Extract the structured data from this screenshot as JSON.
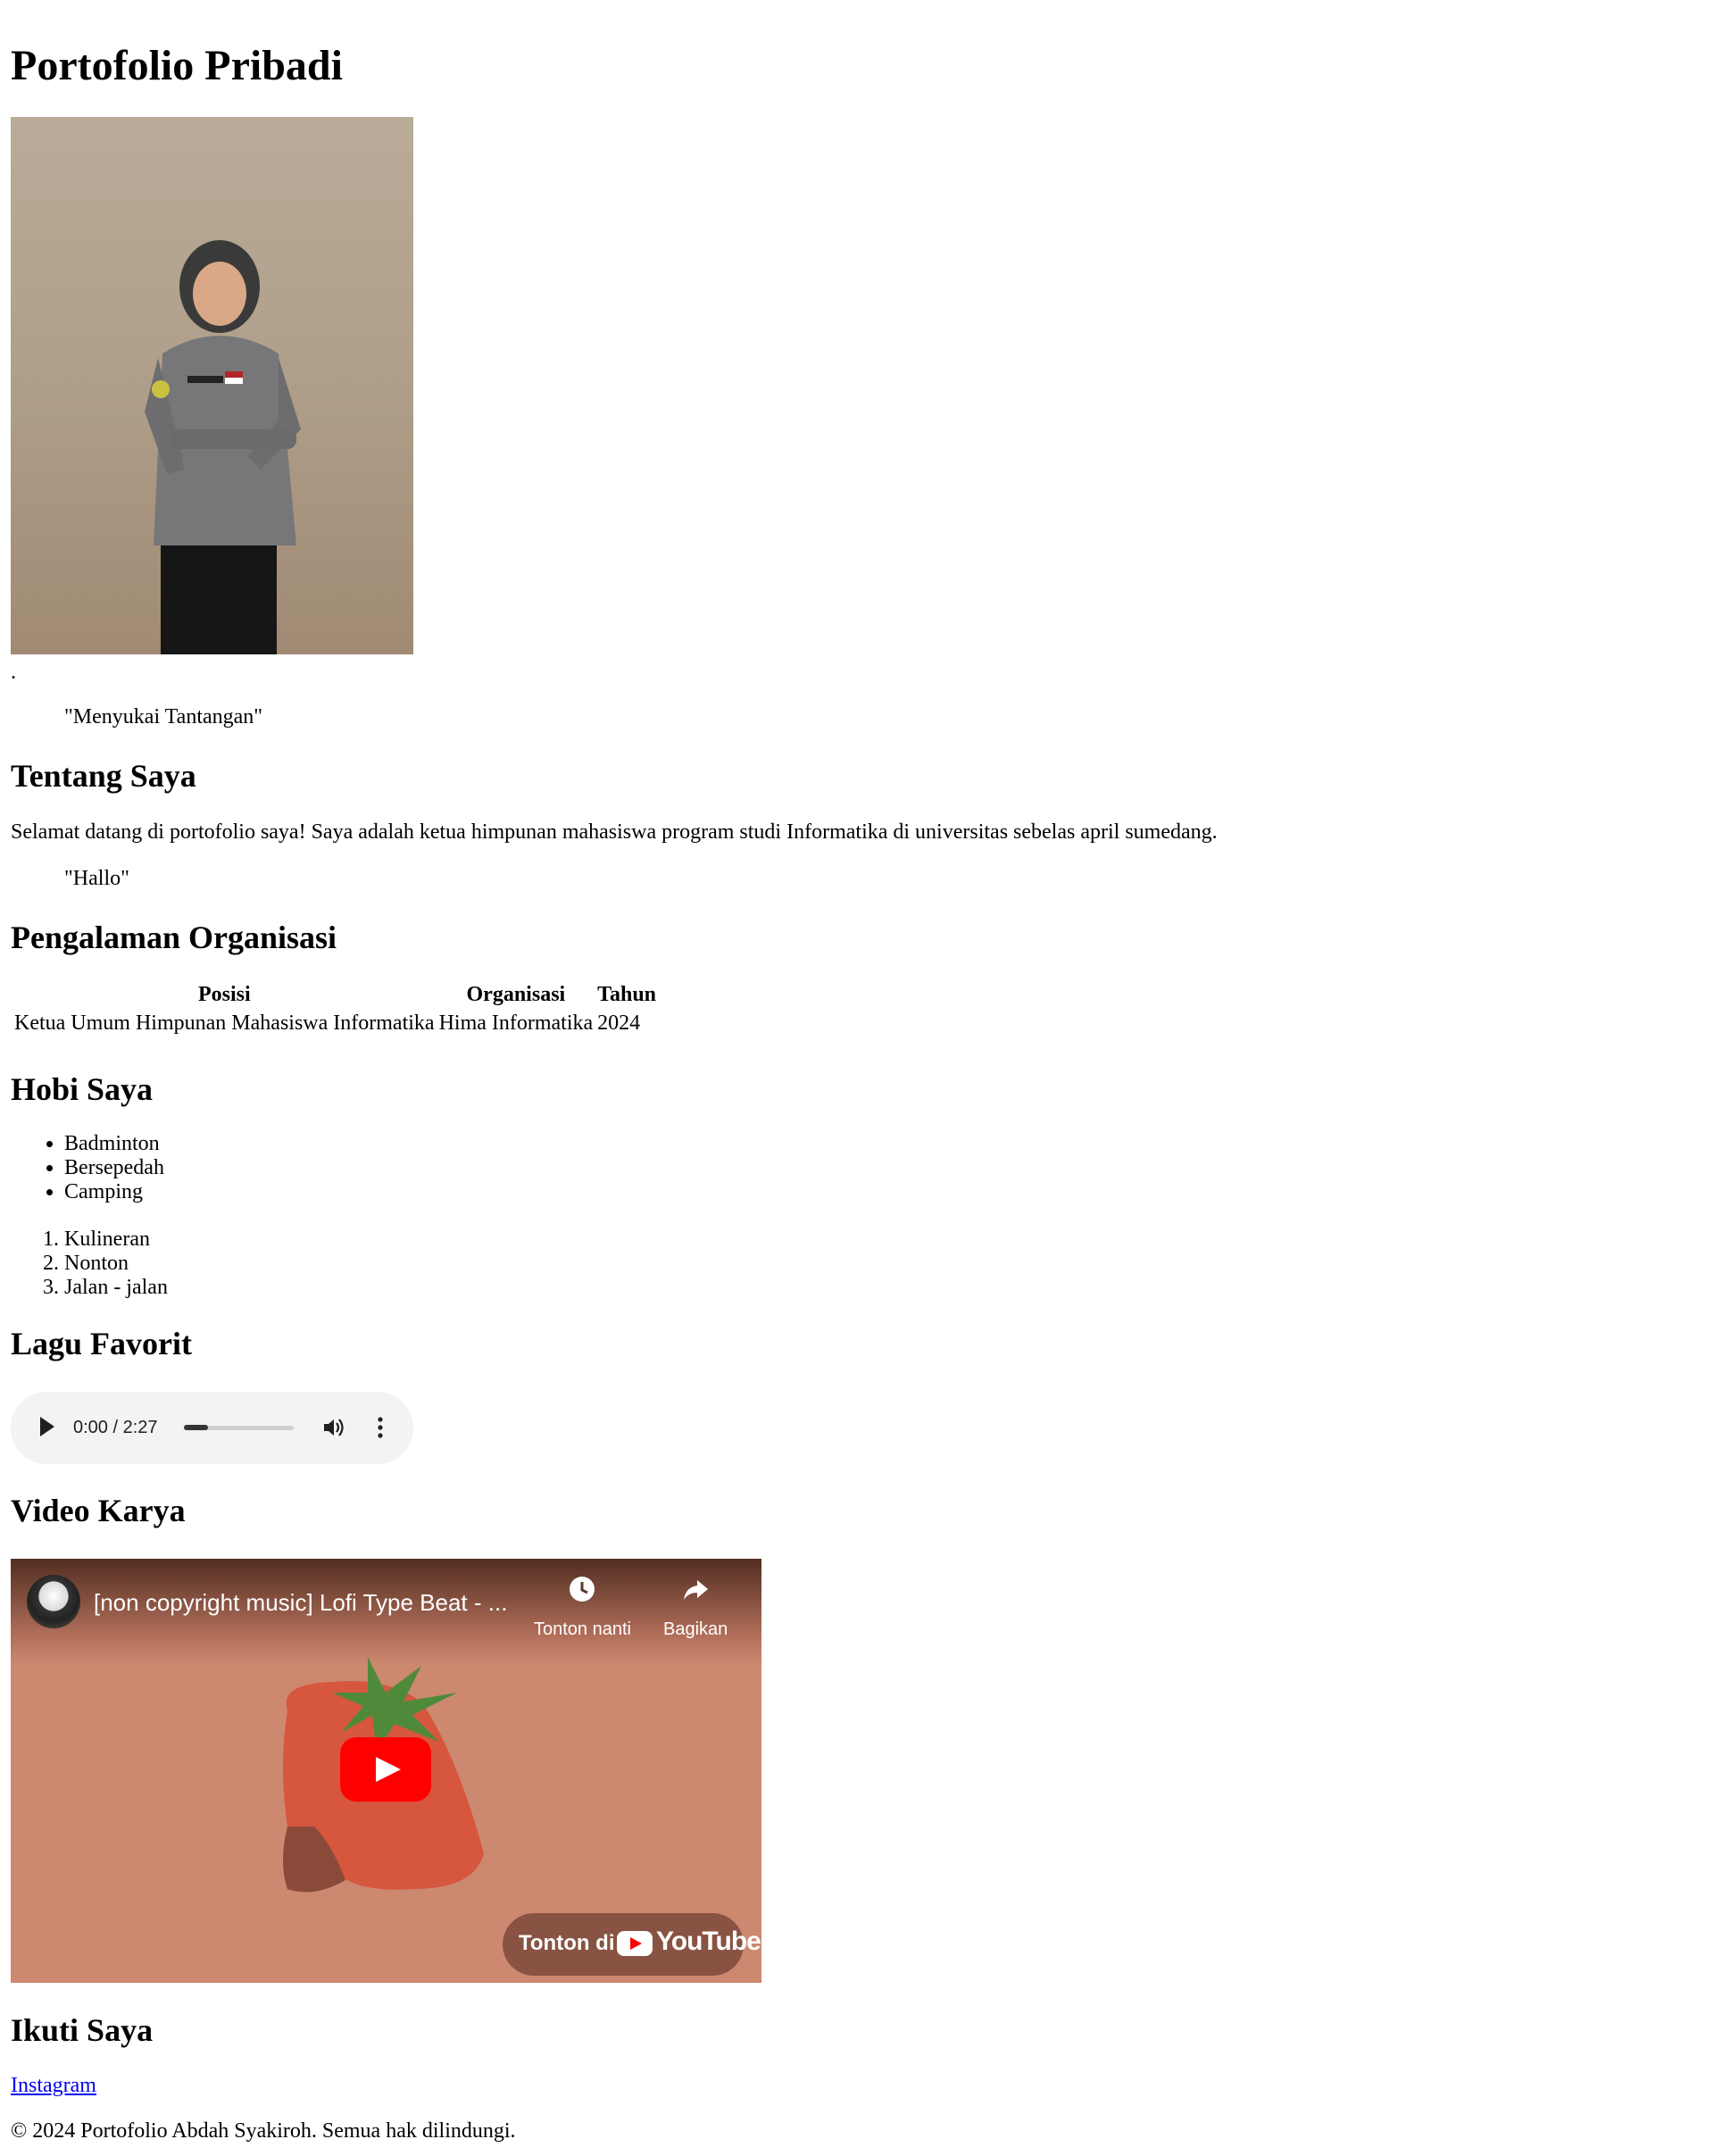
{
  "page": {
    "title": "Portofolio Pribadi",
    "photo_caption_dot": ".",
    "tagline": "\"Menyukai Tantangan\""
  },
  "about": {
    "heading": "Tentang Saya",
    "text": "Selamat datang di portofolio saya! Saya adalah ketua himpunan mahasiswa program studi Informatika di universitas sebelas april sumedang.",
    "quote": "\"Hallo\""
  },
  "experience": {
    "heading": "Pengalaman Organisasi",
    "columns": [
      "Posisi",
      "Organisasi",
      "Tahun"
    ],
    "rows": [
      [
        "Ketua Umum Himpunan Mahasiswa Informatika",
        "Hima Informatika",
        "2024"
      ]
    ]
  },
  "hobbies": {
    "heading": "Hobi Saya",
    "unordered": [
      "Badminton",
      "Bersepedah",
      "Camping"
    ],
    "ordered": [
      "Kulineran",
      "Nonton",
      "Jalan - jalan"
    ]
  },
  "song": {
    "heading": "Lagu Favorit",
    "time": "0:00 / 2:27",
    "progress": 0.22
  },
  "video": {
    "heading": "Video Karya",
    "title": "[non copyright music] Lofi Type Beat - ...",
    "watch_later": "Tonton nanti",
    "share": "Bagikan",
    "watch_on": "Tonton di",
    "youtube": "YouTube"
  },
  "follow": {
    "heading": "Ikuti Saya",
    "instagram": "Instagram"
  },
  "footer": {
    "text": "© 2024 Portofolio Abdah Syakiroh. Semua hak dilindungi."
  }
}
